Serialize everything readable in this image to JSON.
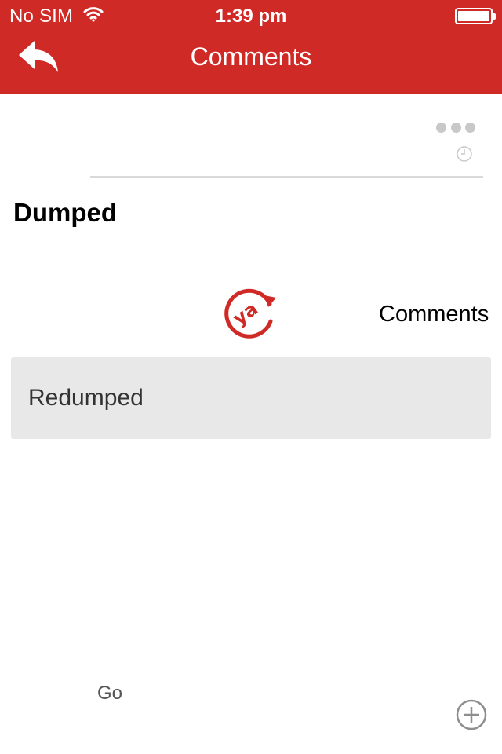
{
  "status_bar": {
    "carrier": "No SIM",
    "time": "1:39 pm"
  },
  "nav": {
    "title": "Comments",
    "back_icon": "reply-arrow-icon"
  },
  "post": {
    "title": "Dumped",
    "more_icon": "more-dots-icon",
    "time_icon": "clock-icon"
  },
  "actions": {
    "logo_text": "ya",
    "comments_label": "Comments",
    "response_label": "Redumped",
    "go_label": "Go",
    "add_icon": "plus-circle-icon"
  },
  "colors": {
    "brand_red": "#d02a26",
    "response_bg": "#e8e8e8",
    "muted_gray": "#c8c8c8"
  }
}
